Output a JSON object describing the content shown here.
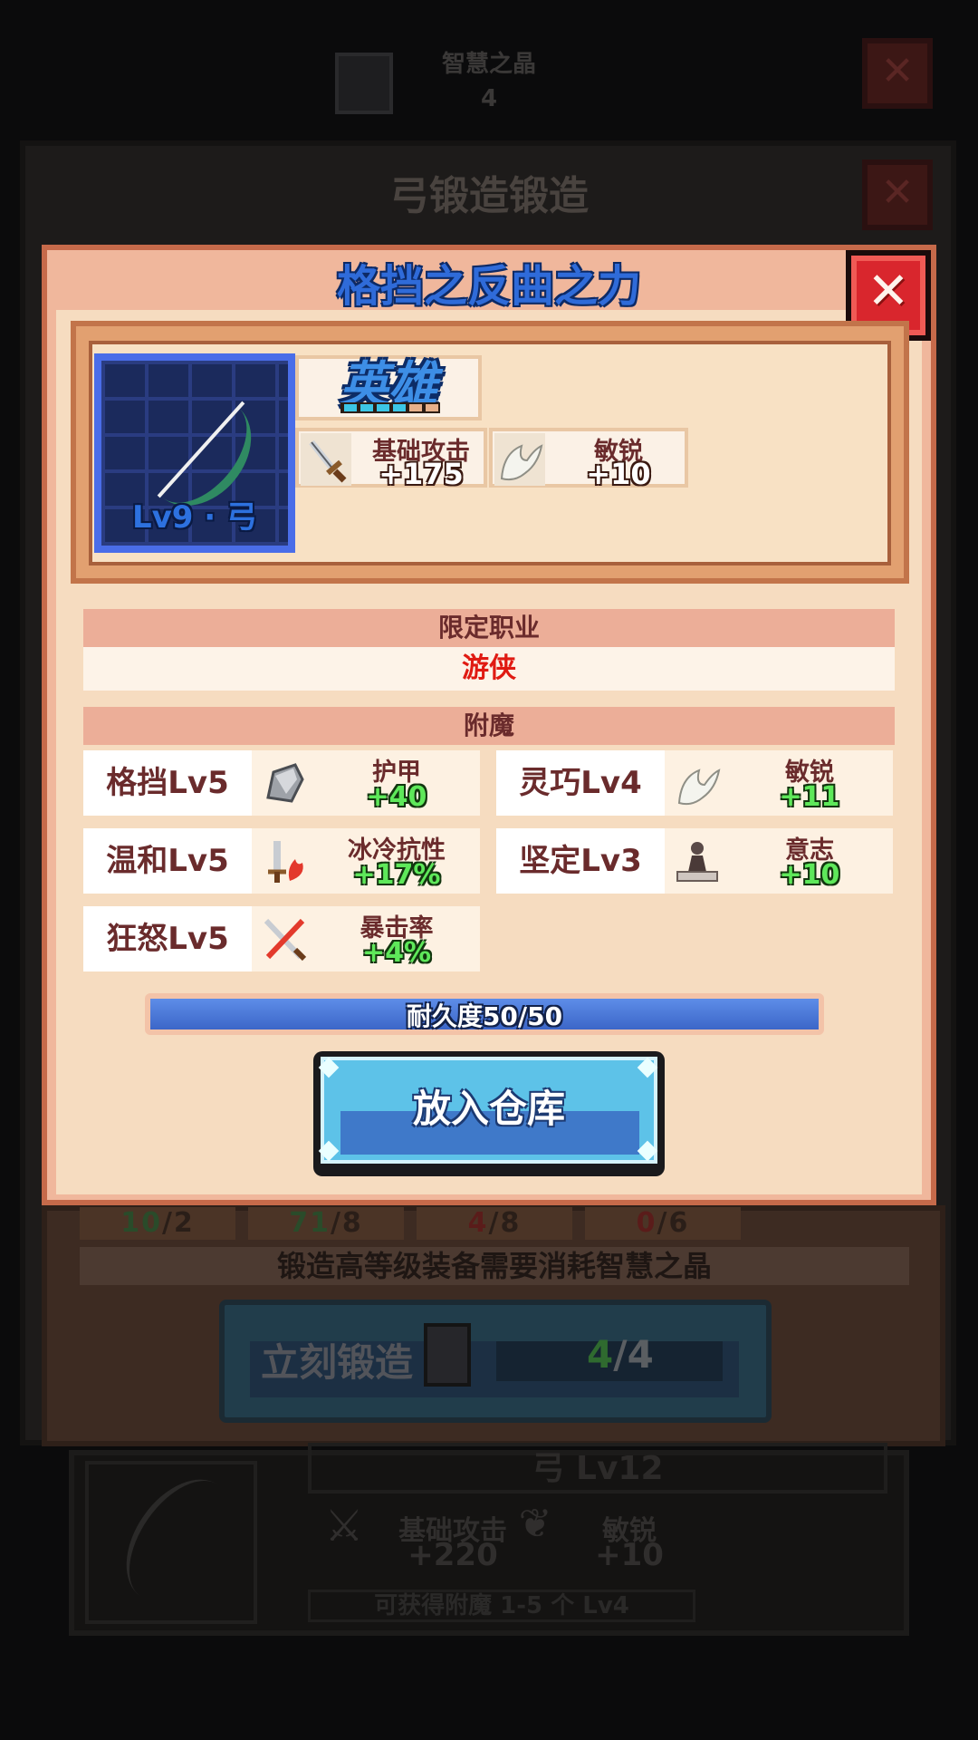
{
  "background": {
    "top_resource_label": "智慧之晶",
    "top_resource_count": "4",
    "forge_panel_title": "弓锻造锻造",
    "material_counts": [
      {
        "have": "10",
        "need": "/2",
        "color": "#2c5a30"
      },
      {
        "have": "71",
        "need": "/8",
        "color": "#2c5a30"
      },
      {
        "have": "4",
        "need": "/8",
        "color": "#6a1e1c"
      },
      {
        "have": "0",
        "need": "/6",
        "color": "#6a1e1c"
      }
    ],
    "forge_note": "锻造高等级装备需要消耗智慧之晶",
    "forge_button_label": "立刻锻造",
    "forge_button_have": "4",
    "forge_button_need": "/4",
    "next_item_level": "弓 Lv12",
    "next_item_stats": [
      {
        "name": "基础攻击",
        "value": "+220"
      },
      {
        "name": "敏锐",
        "value": "+10"
      }
    ],
    "next_item_note": "可获得附魔 1-5 个 Lv4"
  },
  "modal": {
    "title": "格挡之反曲之力",
    "close_icon": "close-icon",
    "item": {
      "level_label": "Lv9 · 弓",
      "rarity": "英雄",
      "rarity_filled_segments": 4,
      "rarity_total_segments": 6,
      "stats": [
        {
          "name": "基础攻击",
          "value": "+175",
          "icon": "sword-icon"
        },
        {
          "name": "敏锐",
          "value": "+10",
          "icon": "wing-icon"
        }
      ]
    },
    "class_restriction": {
      "header": "限定职业",
      "value": "游侠"
    },
    "enchant": {
      "header": "附魔",
      "items": [
        {
          "label": "格挡Lv5",
          "stat": "护甲",
          "value": "+40",
          "icon": "shield-stone-icon"
        },
        {
          "label": "灵巧Lv4",
          "stat": "敏锐",
          "value": "+11",
          "icon": "wing-icon"
        },
        {
          "label": "温和Lv5",
          "stat": "冰冷抗性",
          "value": "+17%",
          "icon": "flame-sword-icon"
        },
        {
          "label": "坚定Lv3",
          "stat": "意志",
          "value": "+10",
          "icon": "statue-icon"
        },
        {
          "label": "狂怒Lv5",
          "stat": "暴击率",
          "value": "+4%",
          "icon": "crossed-swords-icon"
        }
      ]
    },
    "durability": {
      "label": "耐久度50/50",
      "current": 50,
      "max": 50
    },
    "store_button_label": "放入仓库"
  }
}
